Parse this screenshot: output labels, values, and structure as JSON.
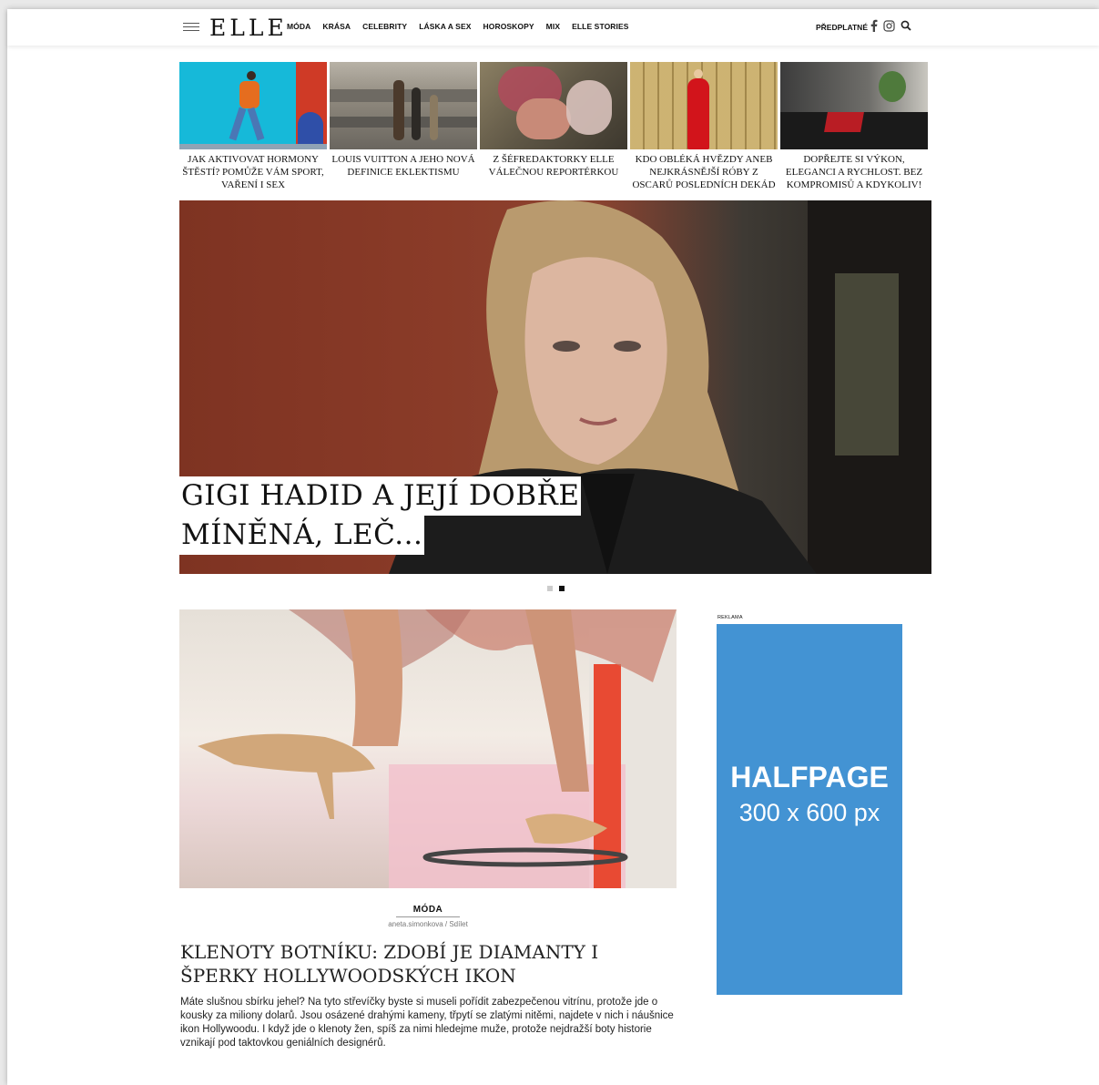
{
  "header": {
    "logo": "ELLE",
    "nav": [
      "MÓDA",
      "KRÁSA",
      "CELEBRITY",
      "LÁSKA A SEX",
      "HOROSKOPY",
      "MIX",
      "ELLE STORIES"
    ],
    "subscribe": "PŘEDPLATNÉ"
  },
  "teasers": [
    {
      "title": "JAK AKTIVOVAT HORMONY ŠTĚSTÍ? POMŮŽE VÁM SPORT, VAŘENÍ I SEX"
    },
    {
      "title": "LOUIS VUITTON A JEHO NOVÁ DEFINICE EKLEKTISMU"
    },
    {
      "title": "Z ŠÉFREDAKTORKY ELLE VÁLEČNOU REPORTÉRKOU"
    },
    {
      "title": "KDO OBLÉKÁ HVĚZDY ANEB NEJKRÁSNĚJŠÍ RÓBY Z OSCARŮ POSLEDNÍCH DEKÁD"
    },
    {
      "title": "DOPŘEJTE SI VÝKON, ELEGANCI A RYCHLOST. BEZ KOMPROMISŮ A KDYKOLIV!"
    }
  ],
  "hero": {
    "title_line1": "GIGI HADID A JEJÍ DOBŘE",
    "title_line2": "MÍNĚNÁ, LEČ..."
  },
  "article": {
    "category": "MÓDA",
    "meta": "aneta.simonkova / Sdílet",
    "title": "KLENOTY BOTNÍKU: ZDOBÍ JE DIAMANTY I ŠPERKY HOLLYWOODSKÝCH IKON",
    "text": "Máte slušnou sbírku jehel? Na tyto střevíčky byste si museli pořídit zabezpečenou vitrínu, protože jde o kousky za miliony dolarů. Jsou osázené drahými kameny, třpytí se zlatými nitěmi, najdete v nich i náušnice ikon Hollywoodu. I když jde o klenoty žen, spíš za nimi hledejme muže, protože nejdražší boty historie vznikají pod taktovkou geniálních designérů."
  },
  "ad": {
    "label": "REKLAMA",
    "line1": "HALFPAGE",
    "line2": "300 x 600 px",
    "color": "#4393d3"
  }
}
